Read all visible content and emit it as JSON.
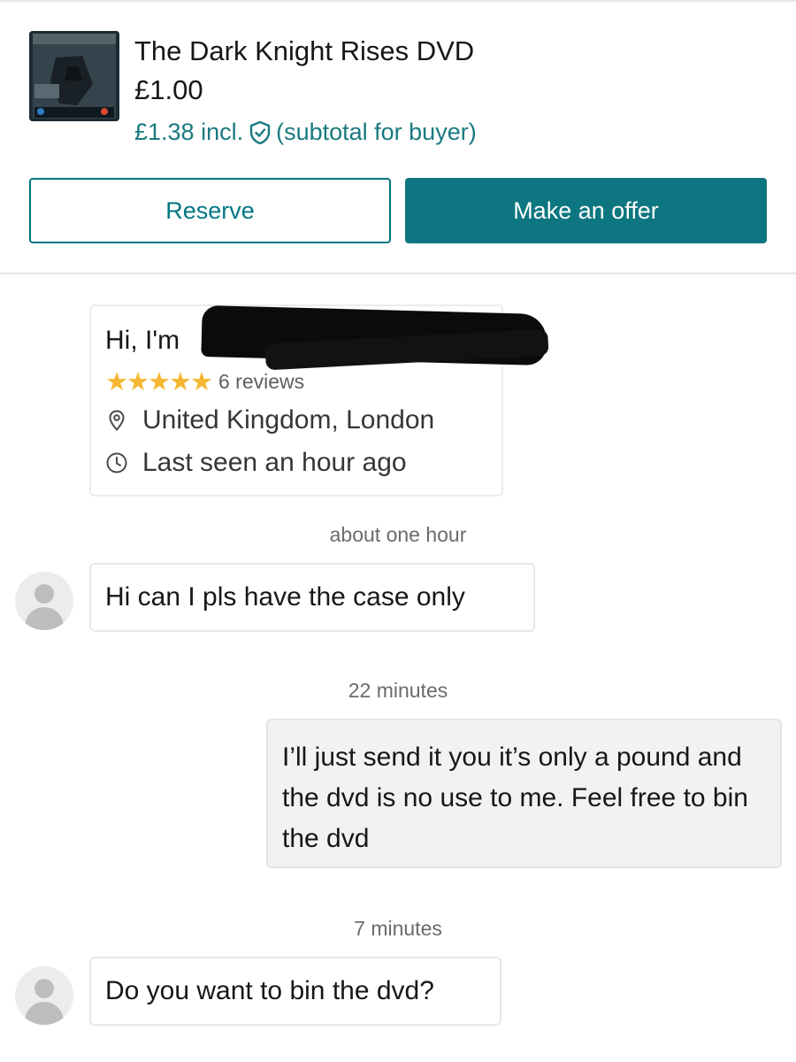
{
  "item": {
    "title": "The Dark Knight Rises DVD",
    "price": "£1.00",
    "buyer_price": "£1.38 incl.",
    "buyer_note": "(subtotal for buyer)",
    "thumbnail_icon": "dvd-cover-thumbnail"
  },
  "actions": {
    "reserve_label": "Reserve",
    "offer_label": "Make an offer"
  },
  "profile": {
    "greeting": "Hi, I'm",
    "stars": "★★★★★",
    "reviews": "6 reviews",
    "location": "United Kingdom, London",
    "last_seen": "Last seen an hour ago"
  },
  "messages": [
    {
      "timestamp": "about one hour",
      "direction": "incoming",
      "text": "Hi can I pls have the case only"
    },
    {
      "timestamp": "22 minutes",
      "direction": "outgoing",
      "text": "I’ll just send it you it’s only a pound and the dvd is no use to me. Feel free to bin the dvd"
    },
    {
      "timestamp": "7 minutes",
      "direction": "incoming",
      "text": "Do you want to bin the dvd?"
    }
  ],
  "colors": {
    "accent": "#007782",
    "button_fill": "#0d7680",
    "star": "#f5b731"
  }
}
